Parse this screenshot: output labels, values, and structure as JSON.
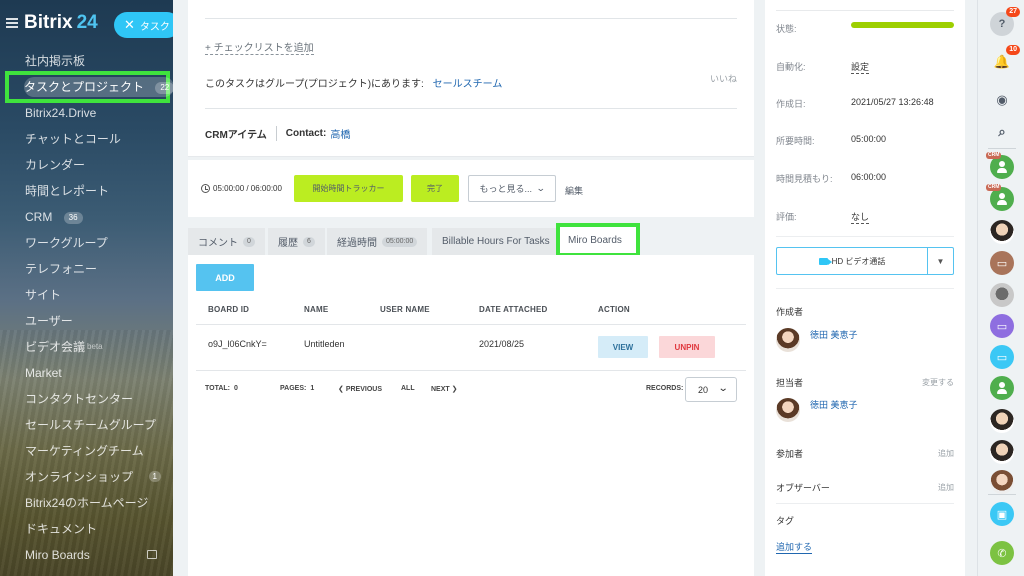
{
  "sidebar": {
    "logo_part1": "Bitrix",
    "logo_part2": "24",
    "task_button": "タスク",
    "items": [
      {
        "label": "社内掲示板"
      },
      {
        "label": "タスクとプロジェクト",
        "badge": "22"
      },
      {
        "label": "Bitrix24.Drive"
      },
      {
        "label": "チャットとコール"
      },
      {
        "label": "カレンダー"
      },
      {
        "label": "時間とレポート"
      },
      {
        "label": "CRM",
        "badge": "36"
      },
      {
        "label": "ワークグループ"
      },
      {
        "label": "テレフォニー"
      },
      {
        "label": "サイト"
      },
      {
        "label": "ユーザー"
      },
      {
        "label": "ビデオ会議",
        "sup": "beta"
      },
      {
        "label": "Market"
      },
      {
        "label": "コンタクトセンター"
      },
      {
        "label": "セールスチームグループ"
      },
      {
        "label": "マーケティングチーム"
      },
      {
        "label": "オンラインショップ",
        "badge": "1"
      },
      {
        "label": "Bitrix24のホームページ"
      },
      {
        "label": "ドキュメント"
      },
      {
        "label": "Miro Boards"
      }
    ]
  },
  "task": {
    "checklist_add": "+ チェックリストを追加",
    "group_text": "このタスクはグループ(プロジェクト)にあります:",
    "group_link": "セールスチーム",
    "like": "いいね",
    "crm_title": "CRMアイテム",
    "contact_label": "Contact:",
    "contact_value": "高橋",
    "timer": "05:00:00 / 06:00:00",
    "start_tracker": "開始時間トラッカー",
    "complete": "完了",
    "more": "もっと見る...",
    "edit": "編集"
  },
  "tabs": [
    {
      "label": "コメント",
      "count": "0"
    },
    {
      "label": "履歴",
      "count": "6"
    },
    {
      "label": "経過時間",
      "count": "05:00:00"
    },
    {
      "label": "Billable Hours For Tasks"
    },
    {
      "label": "Miro Boards"
    }
  ],
  "miro": {
    "add_label": "ADD",
    "columns": [
      "BOARD ID",
      "NAME",
      "USER NAME",
      "DATE ATTACHED",
      "ACTION"
    ],
    "rows": [
      {
        "board_id": "o9J_l06CnkY=",
        "name": "Untitleden",
        "user_name": "",
        "date": "2021/08/25",
        "view": "VIEW",
        "unpin": "UNPIN"
      }
    ],
    "footer": {
      "total_label": "TOTAL:",
      "total_value": "0",
      "pages_label": "PAGES:",
      "pages_value": "1",
      "previous": "PREVIOUS",
      "all": "ALL",
      "next": "NEXT",
      "records_label": "RECORDS:",
      "records_value": "20"
    }
  },
  "info": {
    "status_label": "状態:",
    "status_progress": 1.0,
    "automation_label": "自動化:",
    "automation_value": "設定",
    "created_label": "作成日:",
    "created_value": "2021/05/27 13:26:48",
    "required_label": "所要時間:",
    "required_value": "05:00:00",
    "estimate_label": "時間見積もり:",
    "estimate_value": "06:00:00",
    "rating_label": "評価:",
    "rating_value": "なし",
    "video_label": "HD ビデオ通話",
    "creator_title": "作成者",
    "creator_name": "徳田 美恵子",
    "assignee_title": "担当者",
    "assignee_change": "変更する",
    "assignee_name": "徳田 美恵子",
    "participants_title": "参加者",
    "participants_add": "追加",
    "observers_title": "オブザーバー",
    "observers_add": "追加",
    "tags_title": "タグ",
    "tags_add": "追加する"
  },
  "rightbar": {
    "help_badge": "27",
    "notify_badge": "10",
    "crm_tag": "CRM"
  },
  "colors": {
    "accent_blue": "#2fc6f6",
    "highlight_green": "#3fe33d",
    "button_green": "#bbed21",
    "link_blue": "#2067b0",
    "unpin_red": "#e0383e"
  }
}
